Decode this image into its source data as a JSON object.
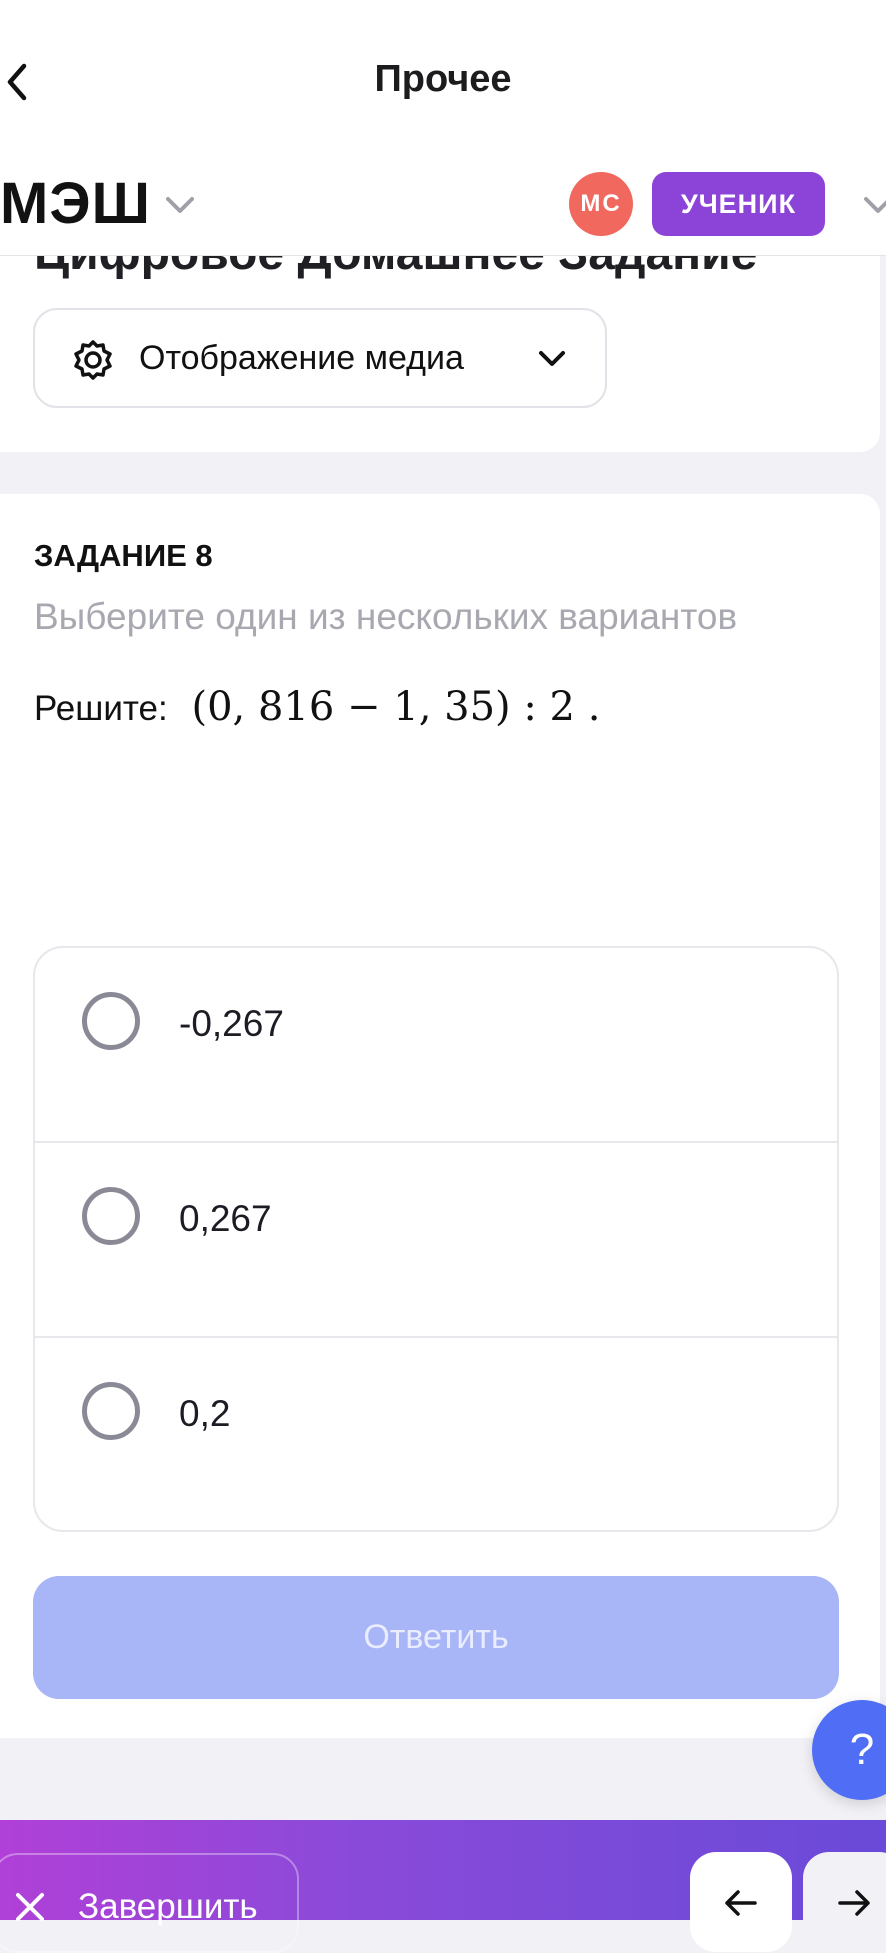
{
  "topbar": {
    "title": "Прочее",
    "back_icon": "chevron-left-icon"
  },
  "appbar": {
    "logo": "МЭШ",
    "avatar_initials": "МС",
    "avatar_color": "#f1685e",
    "role": "УЧЕНИК",
    "role_color": "#8c44d8"
  },
  "card1": {
    "title": "Цифровое Домашнее Задание",
    "media_button": {
      "label": "Отображение медиа",
      "icon": "gear-icon"
    }
  },
  "task": {
    "number_label": "ЗАДАНИЕ 8",
    "hint": "Выберите один из нескольких вариантов",
    "question_prefix": "Решите:",
    "question_expr": "(0, 816 − 1, 35) : 2  .",
    "options": [
      {
        "label": "-0,267"
      },
      {
        "label": "0,267"
      },
      {
        "label": "0,2"
      }
    ],
    "answer_button": "Ответить",
    "answer_button_color": "#a8b5f6"
  },
  "help_button": "?",
  "bottombar": {
    "finish_label": "Завершить",
    "prev_icon": "arrow-left-icon",
    "next_icon": "arrow-right-icon"
  }
}
